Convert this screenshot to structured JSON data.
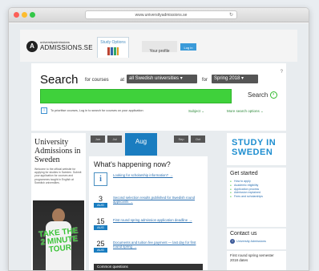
{
  "browser": {
    "url": "www.universityadmissions.se"
  },
  "header": {
    "logo_small": "universityadmissions",
    "logo_text": "ADMISSIONS.SE",
    "tab_active": "Study Options",
    "tab_login": "Your profile",
    "tab_lang": "Log in"
  },
  "search": {
    "title": "Search",
    "for_courses": "for courses",
    "at": "at",
    "university_select": "all Swedish universities",
    "for": "for",
    "term_select": "Spring 2018",
    "button": "Search",
    "login_note": "To prioritise courses, Log in to search for courses on your application",
    "filter_subject": "Subject",
    "filter_more": "More search options"
  },
  "left": {
    "title": "University Admissions in Sweden",
    "description": "Welcome to the official website for applying for studies in Sweden. Submit your application for courses and programmes taught in English at Swedish universities.",
    "tour": "TAKE THE 2 MINUTE TOUR"
  },
  "datebar": {
    "pills": [
      "Jun",
      "Jul",
      "Sep",
      "Oct"
    ],
    "month": "Aug"
  },
  "happening": {
    "title": "What's happening now?",
    "items": [
      {
        "day": "",
        "month": "",
        "text": "Looking for scholarship information? →"
      },
      {
        "day": "3",
        "month": "AUG",
        "text": "Second selection results published for Swedish round applicants →"
      },
      {
        "day": "15",
        "month": "AUG",
        "text": "First round spring admission application deadline →"
      },
      {
        "day": "25",
        "month": "AUG",
        "text": "Documents and tuition fee payment — last day for first round spring →"
      }
    ],
    "common_questions": "Common questions"
  },
  "right": {
    "study_line1": "STUDY IN",
    "study_line2": "SWEDEN",
    "get_started_title": "Get started",
    "get_started_items": [
      "How to apply",
      "Academic eligibility",
      "Application process",
      "Admission explained",
      "Fees and scholarships"
    ],
    "contact_title": "Contact us",
    "contact_row": "University Admissions",
    "first_round": "First round spring semester 2018 dates"
  }
}
